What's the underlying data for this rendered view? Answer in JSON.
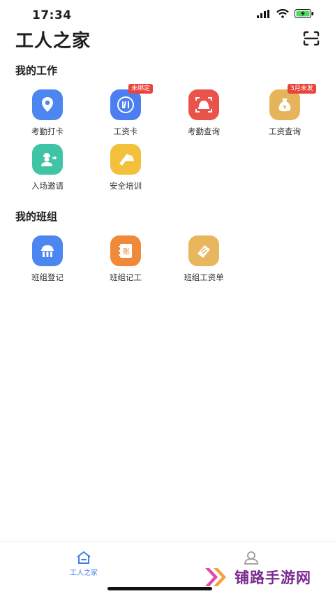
{
  "status_bar": {
    "time": "17:34"
  },
  "header": {
    "title": "工人之家"
  },
  "sections": [
    {
      "title": "我的工作",
      "items": [
        {
          "label": "考勤打卡",
          "icon": "location-pin-icon",
          "color": "#4c86f0",
          "tag": ""
        },
        {
          "label": "工资卡",
          "icon": "bank-card-icon",
          "color": "#4c7ef2",
          "tag": "未绑定"
        },
        {
          "label": "考勤查询",
          "icon": "helmet-scan-icon",
          "color": "#e9534a",
          "tag": ""
        },
        {
          "label": "工资查询",
          "icon": "money-bag-icon",
          "color": "#e6b45a",
          "tag": "3月未发"
        },
        {
          "label": "入场邀请",
          "icon": "worker-invite-icon",
          "color": "#3fc5a5",
          "tag": ""
        },
        {
          "label": "安全培训",
          "icon": "safety-training-icon",
          "color": "#f2c03a",
          "tag": ""
        }
      ]
    },
    {
      "title": "我的班组",
      "items": [
        {
          "label": "班组登记",
          "icon": "team-building-icon",
          "color": "#4c86f0",
          "tag": ""
        },
        {
          "label": "班组记工",
          "icon": "ledger-book-icon",
          "color": "#f08a3a",
          "tag": ""
        },
        {
          "label": "班组工资单",
          "icon": "payslip-icon",
          "color": "#e8b65c",
          "tag": ""
        }
      ]
    }
  ],
  "tabbar": {
    "tabs": [
      {
        "label": "工人之家",
        "active": true
      },
      {
        "label": "",
        "active": false
      }
    ],
    "active_color": "#3f7fe8"
  },
  "watermark": {
    "text": "铺路手游网"
  }
}
